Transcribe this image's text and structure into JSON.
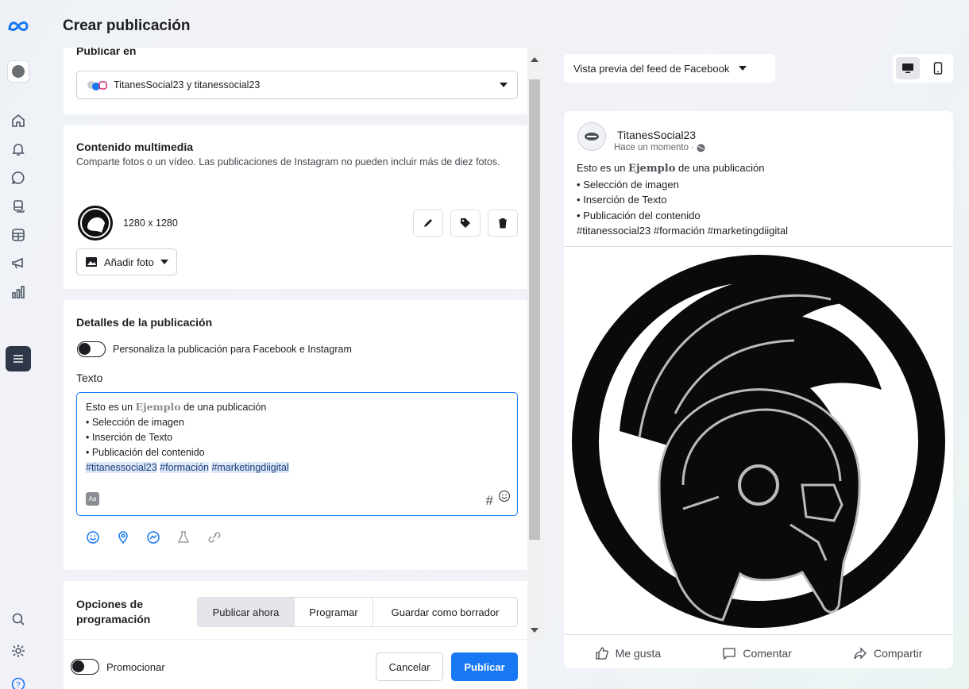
{
  "header": {
    "title": "Crear publicación"
  },
  "publish_in": {
    "label": "Publicar en",
    "selected": "TitanesSocial23 y titanessocial23"
  },
  "media": {
    "title": "Contenido multimedia",
    "description": "Comparte fotos o un vídeo. Las publicaciones de Instagram no pueden incluir más de diez fotos.",
    "image_size": "1280 x 1280",
    "add_photo": "Añadir foto"
  },
  "details": {
    "title": "Detalles de la publicación",
    "customize_label": "Personaliza la publicación para Facebook e Instagram",
    "text_label": "Texto",
    "text_lines": {
      "l1_pre": "Esto es un ",
      "l1_bold": "Ejemplo",
      "l1_post": " de una publicación",
      "l2": "• Selección de imagen",
      "l3": "• Inserción de Texto",
      "l4": "• Publicación del contenido",
      "tag1": "#titanessocial23",
      "tag2": "#formación",
      "tag3": "#marketingdiigital"
    },
    "hash_symbol": "#"
  },
  "scheduling": {
    "title": "Opciones de programación",
    "options": [
      "Publicar ahora",
      "Programar",
      "Guardar como borrador"
    ],
    "active": "Publicar ahora"
  },
  "footer": {
    "promote_label": "Promocionar",
    "cancel": "Cancelar",
    "publish": "Publicar"
  },
  "preview": {
    "selector": "Vista previa del feed de Facebook",
    "page_name": "TitanesSocial23",
    "timestamp": "Hace un momento ·",
    "actions": {
      "like": "Me gusta",
      "comment": "Comentar",
      "share": "Compartir"
    }
  },
  "colors": {
    "primary": "#1877f2",
    "rail_active": "#2d3748",
    "hashtag_bg": "#dce7f8"
  },
  "icons": [
    "meta-logo-icon",
    "home-icon",
    "bell-icon",
    "chat-icon",
    "copy-icon",
    "table-icon",
    "megaphone-icon",
    "bar-chart-icon",
    "menu-icon",
    "search-icon",
    "settings-icon",
    "help-icon"
  ]
}
